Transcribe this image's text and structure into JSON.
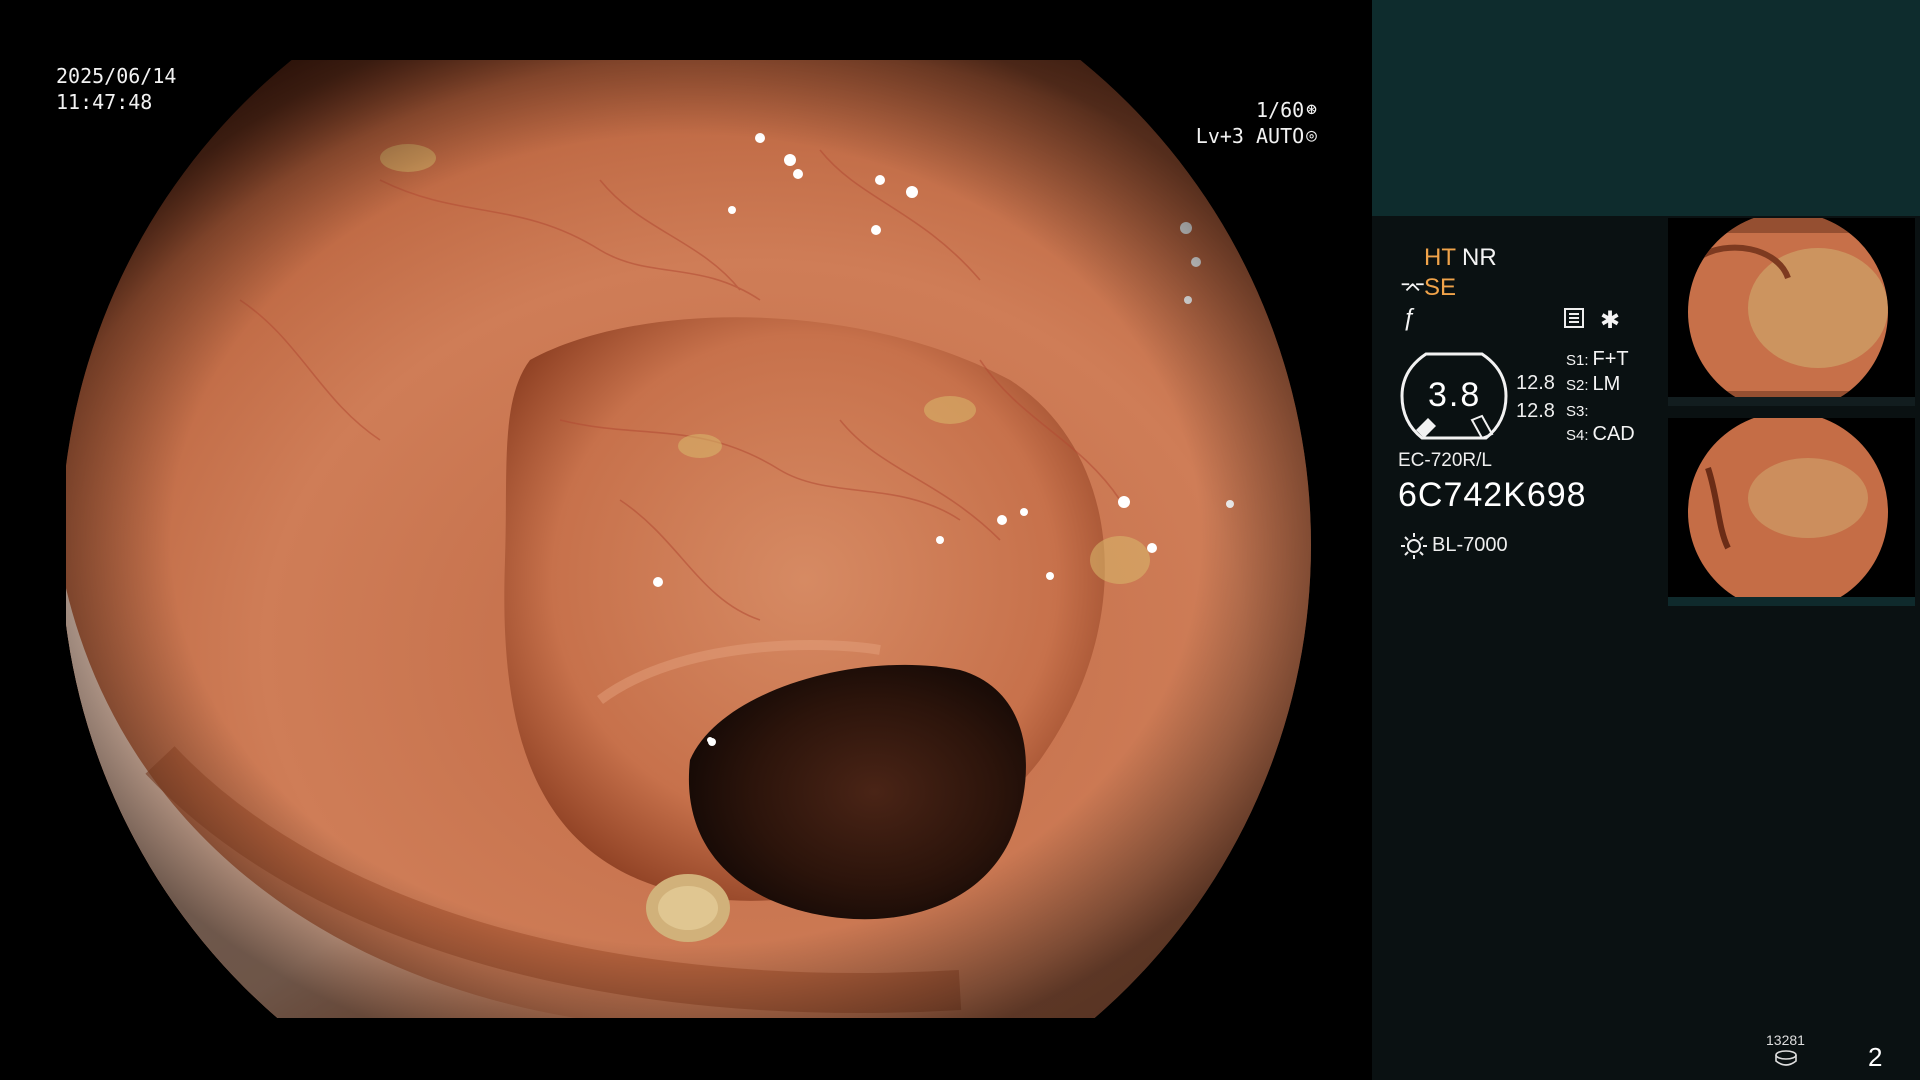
{
  "overlay": {
    "date": "2025/06/14",
    "time": "11:47:48",
    "shutter_speed": "1/60",
    "iris_mode": "Lv+3 AUTO"
  },
  "panel": {
    "modes": {
      "ht": "HT",
      "nr": "NR",
      "se": "SE"
    },
    "enhancement_value": "3.8",
    "gauge_a": "12.8",
    "gauge_b": "12.8",
    "switches": [
      {
        "key": "S1:",
        "value": "F+T"
      },
      {
        "key": "S2:",
        "value": "LM"
      },
      {
        "key": "S3:",
        "value": ""
      },
      {
        "key": "S4:",
        "value": "CAD"
      }
    ],
    "scope_model": "EC-720R/L",
    "scope_serial": "6C742K698",
    "light_source": "BL-7000",
    "image_counter": "13281",
    "page_number": "2"
  },
  "colors": {
    "mode_active": "#f0a34a",
    "panel_bg": "#0a1112",
    "panel_top": "#0e2c2d",
    "mucosa": "#c9714a"
  },
  "icons": {
    "shutter": "aperture-icon",
    "iris": "iris-icon",
    "light": "light-source-icon",
    "menu": "menu-list-icon",
    "disc": "media-disc-icon"
  }
}
